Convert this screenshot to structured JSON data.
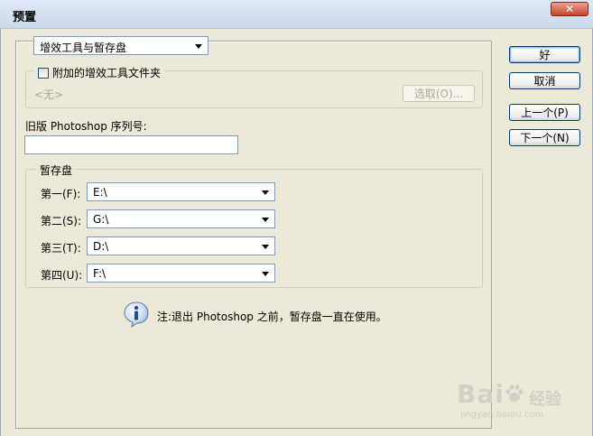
{
  "window": {
    "title": "预置",
    "close_label": "✕"
  },
  "section_select": {
    "value": "增效工具与暂存盘"
  },
  "plugins": {
    "checkbox_label": "附加的增效工具文件夹",
    "folder_value": "<无>",
    "choose_button": "选取(O)..."
  },
  "serial": {
    "label": "旧版 Photoshop 序列号:",
    "value": ""
  },
  "scratch": {
    "legend": "暂存盘",
    "disks": [
      {
        "label": "第一(F):",
        "value": "E:\\"
      },
      {
        "label": "第二(S):",
        "value": "G:\\"
      },
      {
        "label": "第三(T):",
        "value": "D:\\"
      },
      {
        "label": "第四(U):",
        "value": "F:\\"
      }
    ]
  },
  "note": {
    "text": "注:退出 Photoshop 之前，暂存盘一直在使用。",
    "icon": "info-icon"
  },
  "buttons": {
    "ok": "好",
    "cancel": "取消",
    "prev": "上一个(P)",
    "next": "下一个(N)"
  },
  "watermark": {
    "brand": "Bai",
    "product": "经验",
    "url": "jingyan.baidu.com"
  }
}
